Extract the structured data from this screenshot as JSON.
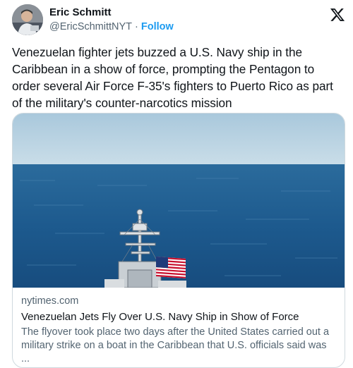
{
  "author": {
    "name": "Eric Schmitt",
    "handle": "@EricSchmittNYT",
    "separator": "·",
    "follow_label": "Follow"
  },
  "platform_icon": "x-logo-icon",
  "tweet": {
    "text": "Venezuelan fighter jets buzzed a  U.S. Navy ship in the Caribbean in a show of force, prompting the Pentagon to order several Air Force F-35's fighters to Puerto Rico as part of the military's counter-narcotics mission"
  },
  "link_card": {
    "domain": "nytimes.com",
    "title": "Venezuelan Jets Fly Over U.S. Navy Ship in Show of Force",
    "description": "The flyover took place two days after the United States carried out a military strike on a boat in the Caribbean that U.S. officials said was ..."
  },
  "colors": {
    "accent": "#1d9bf0",
    "text_primary": "#0f1419",
    "text_secondary": "#536471",
    "card_border": "#cfd9de",
    "sky": "#b9d3e3",
    "sea": "#1f5b8f"
  }
}
